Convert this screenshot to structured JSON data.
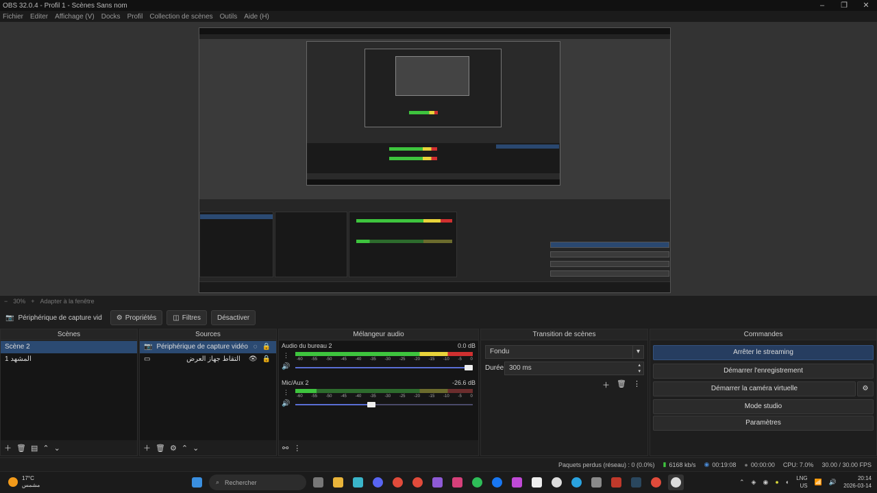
{
  "window": {
    "title": "OBS 32.0.4 - Profil 1 - Scènes Sans nom"
  },
  "menu": [
    "Fichier",
    "Editer",
    "Affichage (V)",
    "Docks",
    "Profil",
    "Collection de scènes",
    "Outils",
    "Aide (H)"
  ],
  "zoom": {
    "level": "30%",
    "label": "Adapter à la fenêtre"
  },
  "source_toolbar": {
    "device": "Périphérique de capture vid",
    "properties": "Propriétés",
    "filters": "Filtres",
    "deactivate": "Désactiver"
  },
  "scenes": {
    "header": "Scènes",
    "items": [
      "Scène 2",
      "المشهد 1"
    ]
  },
  "sources": {
    "header": "Sources",
    "items": [
      "Périphérique de capture vidéo",
      "التقاط جهاز العرض"
    ]
  },
  "mixer": {
    "header": "Mélangeur audio",
    "channels": [
      {
        "name": "Audio du bureau 2",
        "db": "0.0 dB",
        "volume": 1.0
      },
      {
        "name": "Mic/Aux 2",
        "db": "-26.6 dB",
        "volume": 0.45
      }
    ],
    "scale": [
      "-60",
      "-55",
      "-50",
      "-45",
      "-40",
      "-35",
      "-30",
      "-25",
      "-20",
      "-15",
      "-10",
      "-5",
      "0"
    ]
  },
  "transitions": {
    "header": "Transition de scènes",
    "type": "Fondu",
    "duration_label": "Durée",
    "duration": "300 ms"
  },
  "controls": {
    "header": "Commandes",
    "stop_streaming": "Arrêter le streaming",
    "start_recording": "Démarrer l'enregistrement",
    "start_virtual_camera": "Démarrer la caméra virtuelle",
    "studio_mode": "Mode studio",
    "settings": "Paramètres"
  },
  "status": {
    "dropped": "Paquets perdus (réseau) : 0 (0.0%)",
    "bitrate": "6168 kb/s",
    "stream_time": "00:19:08",
    "rec_time": "00:00:00",
    "cpu": "CPU: 7.0%",
    "fps": "30.00 / 30.00 FPS"
  },
  "taskbar": {
    "temp": "17°C",
    "weather": "مشمس",
    "search": "Rechercher",
    "lang": "LNG",
    "layout": "US",
    "time": "20:14",
    "date": "2026-03-14"
  },
  "colors": {
    "accent": "#2b4a72",
    "meter_green": "#3ec43e",
    "meter_yellow": "#e8d33a",
    "meter_red": "#d03030"
  }
}
